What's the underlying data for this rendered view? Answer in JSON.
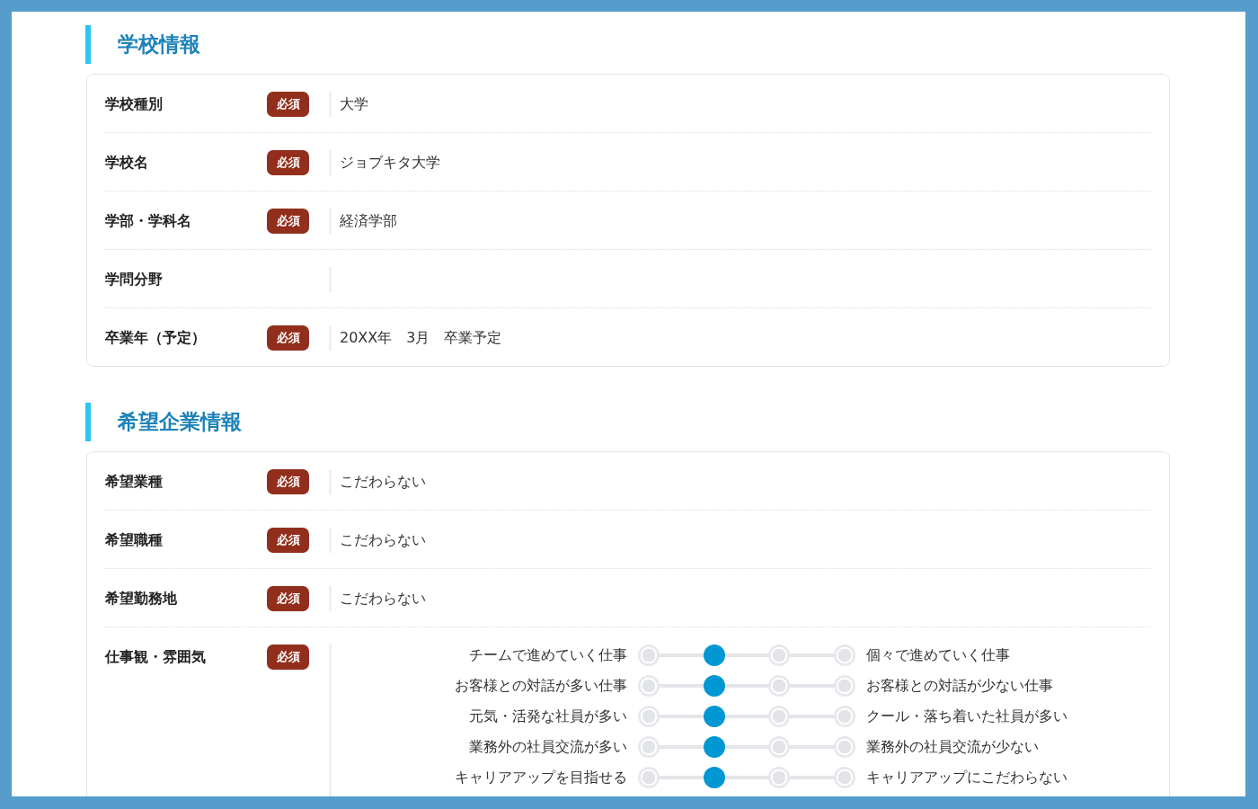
{
  "sections": [
    {
      "title": "学校情報",
      "rows": [
        {
          "kind": "text",
          "label": "学校種別",
          "badge": "必須",
          "value": "大学"
        },
        {
          "kind": "text",
          "label": "学校名",
          "badge": "必須",
          "value": "ジョブキタ大学"
        },
        {
          "kind": "text",
          "label": "学部・学科名",
          "badge": "必須",
          "value": "経済学部"
        },
        {
          "kind": "text",
          "label": "学問分野"
        },
        {
          "kind": "text",
          "label": "卒業年（予定）",
          "badge": "必須",
          "value": "20XX年　3月　卒業予定"
        }
      ]
    },
    {
      "title": "希望企業情報",
      "rows": [
        {
          "kind": "text",
          "label": "希望業種",
          "badge": "必須",
          "value": "こだわらない"
        },
        {
          "kind": "text",
          "label": "希望職種",
          "badge": "必須",
          "value": "こだわらない"
        },
        {
          "kind": "text",
          "label": "希望勤務地",
          "badge": "必須",
          "value": "こだわらない"
        },
        {
          "kind": "scale",
          "label": "仕事観・雰囲気",
          "badge": "必須",
          "scales": [
            {
              "left": "チームで進めていく仕事",
              "right": "個々で進めていく仕事",
              "choices": [
                {
                  "selected": false
                },
                {
                  "selected": true
                },
                {
                  "selected": false
                },
                {
                  "selected": false
                }
              ]
            },
            {
              "left": "お客様との対話が多い仕事",
              "right": "お客様との対話が少ない仕事",
              "choices": [
                {
                  "selected": false
                },
                {
                  "selected": true
                },
                {
                  "selected": false
                },
                {
                  "selected": false
                }
              ]
            },
            {
              "left": "元気・活発な社員が多い",
              "right": "クール・落ち着いた社員が多い",
              "choices": [
                {
                  "selected": false
                },
                {
                  "selected": true
                },
                {
                  "selected": false
                },
                {
                  "selected": false
                }
              ]
            },
            {
              "left": "業務外の社員交流が多い",
              "right": "業務外の社員交流が少ない",
              "choices": [
                {
                  "selected": false
                },
                {
                  "selected": true
                },
                {
                  "selected": false
                },
                {
                  "selected": false
                }
              ]
            },
            {
              "left": "キャリアアップを目指せる",
              "right": "キャリアアップにこだわらない",
              "choices": [
                {
                  "selected": false
                },
                {
                  "selected": true
                },
                {
                  "selected": false
                },
                {
                  "selected": false
                }
              ]
            }
          ]
        }
      ]
    }
  ]
}
